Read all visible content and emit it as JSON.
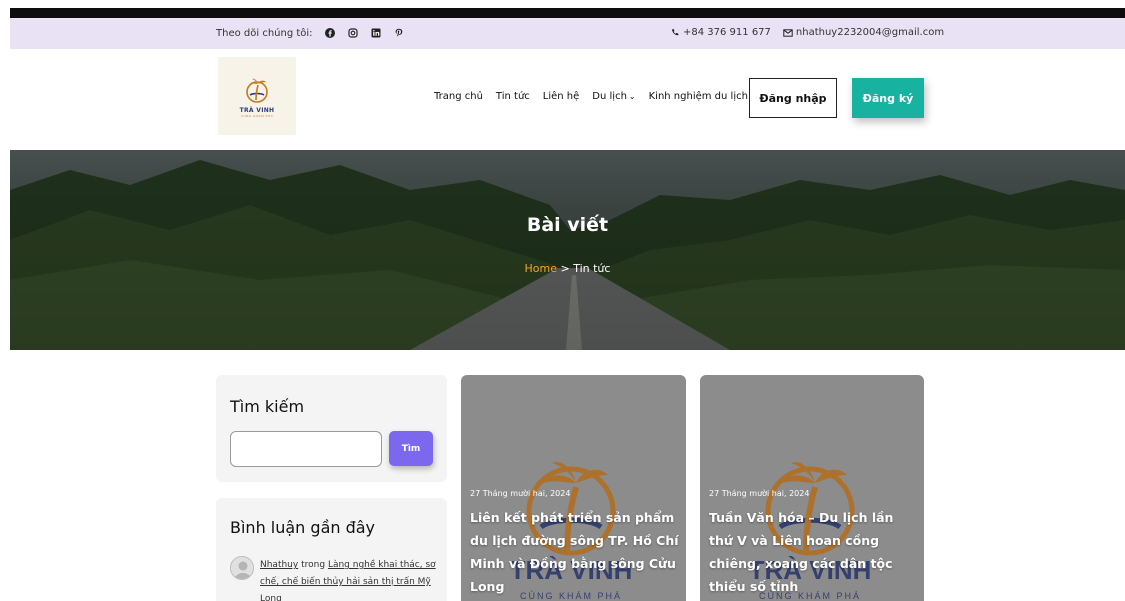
{
  "topbar": {
    "follow_label": "Theo dõi chúng tôi:",
    "social_icons": [
      "facebook-icon",
      "instagram-icon",
      "linkedin-icon",
      "pinterest-icon"
    ],
    "phone": "+84 376 911 677",
    "email": "nhathuy2232004@gmail.com",
    "background": "#e8e2f4"
  },
  "logo": {
    "brand": "TRÀ VINH",
    "tagline": "CÙNG KHÁM PHÁ"
  },
  "nav": {
    "items": [
      "Trang chủ",
      "Tin tức",
      "Liên hệ",
      "Du lịch",
      "Kinh nghiệm du lịch"
    ],
    "login_label": "Đăng nhập",
    "register_label": "Đăng ký",
    "accent": "#17b3a0"
  },
  "hero": {
    "title": "Bài viết",
    "breadcrumb_home": "Home",
    "breadcrumb_sep": ">",
    "breadcrumb_current": "Tin tức",
    "breadcrumb_home_color": "#f5a623"
  },
  "sidebar": {
    "search": {
      "heading": "Tìm kiếm",
      "input_value": "",
      "button_label": "Tìm",
      "button_color": "#7b68ee"
    },
    "recent_comments": {
      "heading": "Bình luận gần đây",
      "items": [
        {
          "author": "Nhathuy",
          "connector": "trong",
          "post": "Làng nghề khai thác, sơ chế, chế biến thủy hải sản thị trấn Mỹ Long"
        }
      ]
    }
  },
  "posts": [
    {
      "date": "27 Tháng mười hai, 2024",
      "title": "Liên kết phát triển sản phẩm du lịch đường sông TP. Hồ Chí Minh và Đồng bằng sông Cửu Long"
    },
    {
      "date": "27 Tháng mười hai, 2024",
      "title": "Tuần Văn hóa – Du lịch lần thứ V và Liên hoan cồng chiêng, xoang các dân tộc thiểu số tỉnh"
    }
  ]
}
